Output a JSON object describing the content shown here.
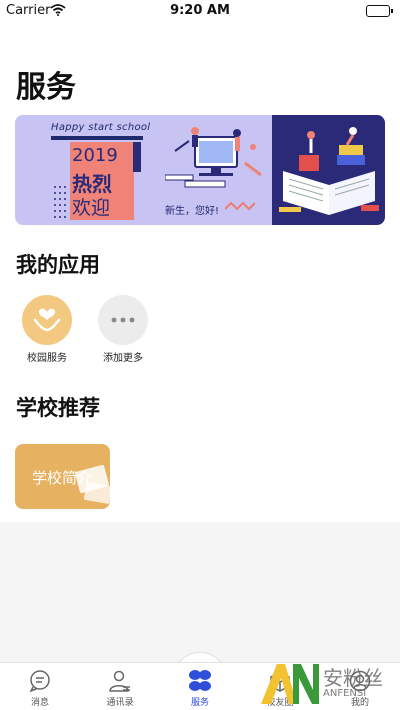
{
  "status_bar": {
    "carrier": "Carrier",
    "time": "9:20 AM"
  },
  "page": {
    "title": "服务"
  },
  "banner": {
    "tagline": "Happy start school",
    "year": "2019",
    "hot": "热烈",
    "welcome": "欢迎",
    "greeting": "新生，您好!"
  },
  "my_apps": {
    "title": "我的应用",
    "items": [
      {
        "label": "校园服务",
        "icon": "hands-heart-icon",
        "color": "#f3c982"
      },
      {
        "label": "添加更多",
        "icon": "more-dots-icon",
        "color": "#ececec"
      }
    ]
  },
  "school_recommend": {
    "title": "学校推荐",
    "card_label": "学校简介",
    "card_color": "#e6b160"
  },
  "tabs": [
    {
      "label": "消息",
      "icon": "message-icon"
    },
    {
      "label": "通讯录",
      "icon": "contacts-icon"
    },
    {
      "label": "服务",
      "icon": "services-icon",
      "active": true
    },
    {
      "label": "校友圈",
      "icon": "alumni-icon"
    },
    {
      "label": "我的",
      "icon": "profile-icon"
    }
  ],
  "accent_color": "#2f4fd8",
  "watermark": {
    "cn": "安粉丝",
    "en": "ANFENSI"
  }
}
